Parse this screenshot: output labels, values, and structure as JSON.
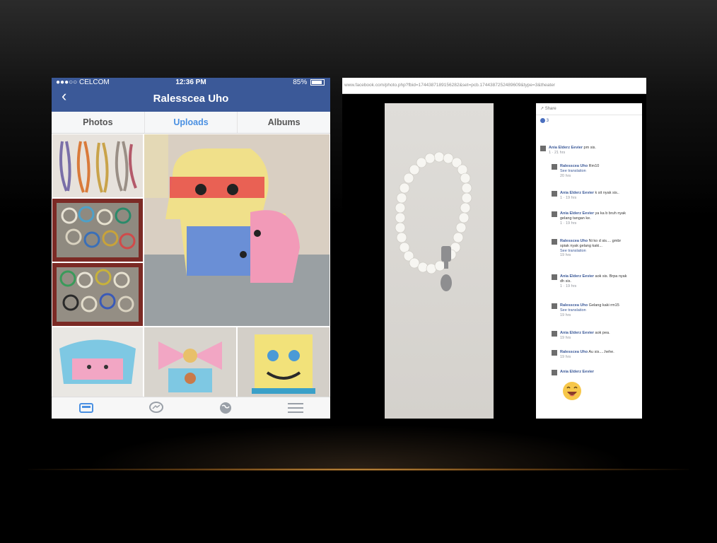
{
  "phone": {
    "status": {
      "carrier": "●●●○○ CELCOM",
      "time": "12:36 PM",
      "battery": "85%"
    },
    "nav_title": "Ralesscea Uho",
    "tabs": [
      {
        "label": "Photos",
        "active": false
      },
      {
        "label": "Uploads",
        "active": true
      },
      {
        "label": "Albums",
        "active": false
      }
    ],
    "bottom_icons": [
      "news-feed-icon",
      "messenger-icon",
      "globe-icon",
      "menu-icon"
    ],
    "accent_color": "#3b5998",
    "active_tab_color": "#4a90e2"
  },
  "browser": {
    "url": "www.facebook.com/photo.php?fbid=1744387189156282&set=pcb.1744387252489609&type=3&theater",
    "share_label": "Share",
    "like_count": "3",
    "comments": [
      {
        "name": "Ania Elderz Eevier",
        "text": "pm sis.",
        "meta": "1 · 21 hrs"
      },
      {
        "name": "Ralesscea Uho",
        "text": "Rm10",
        "link": "See translation",
        "meta": "20 hrs"
      },
      {
        "name": "Ania Elderz Eevier",
        "text": "k sit nyak sis..",
        "meta": "1 · 19 hrs"
      },
      {
        "name": "Ania Elderz Eevier",
        "text": "ya ka b bruh nyak gelang tangan ke.",
        "meta": "1 · 19 hrs"
      },
      {
        "name": "Ralesscea Uho",
        "text": "Ni ko d sis.... gmbr spiak nyak gelang kaki...",
        "link": "See translation",
        "meta": "19 hrs"
      },
      {
        "name": "Ania Elderz Eevier",
        "text": "aok sis. Brpa nyak dh sis.",
        "meta": "1 · 19 hrs"
      },
      {
        "name": "Ralesscea Uho",
        "text": "Gelang kaki rm15",
        "link": "See translation",
        "meta": "19 hrs"
      },
      {
        "name": "Ania Elderz Eevier",
        "text": "aok pea.",
        "meta": "19 hrs"
      },
      {
        "name": "Ralesscea Uho",
        "text": "Au sis.....hehe.",
        "meta": "19 hrs"
      },
      {
        "name": "Ania Elderz Eevier",
        "text": "",
        "meta": ""
      }
    ]
  }
}
